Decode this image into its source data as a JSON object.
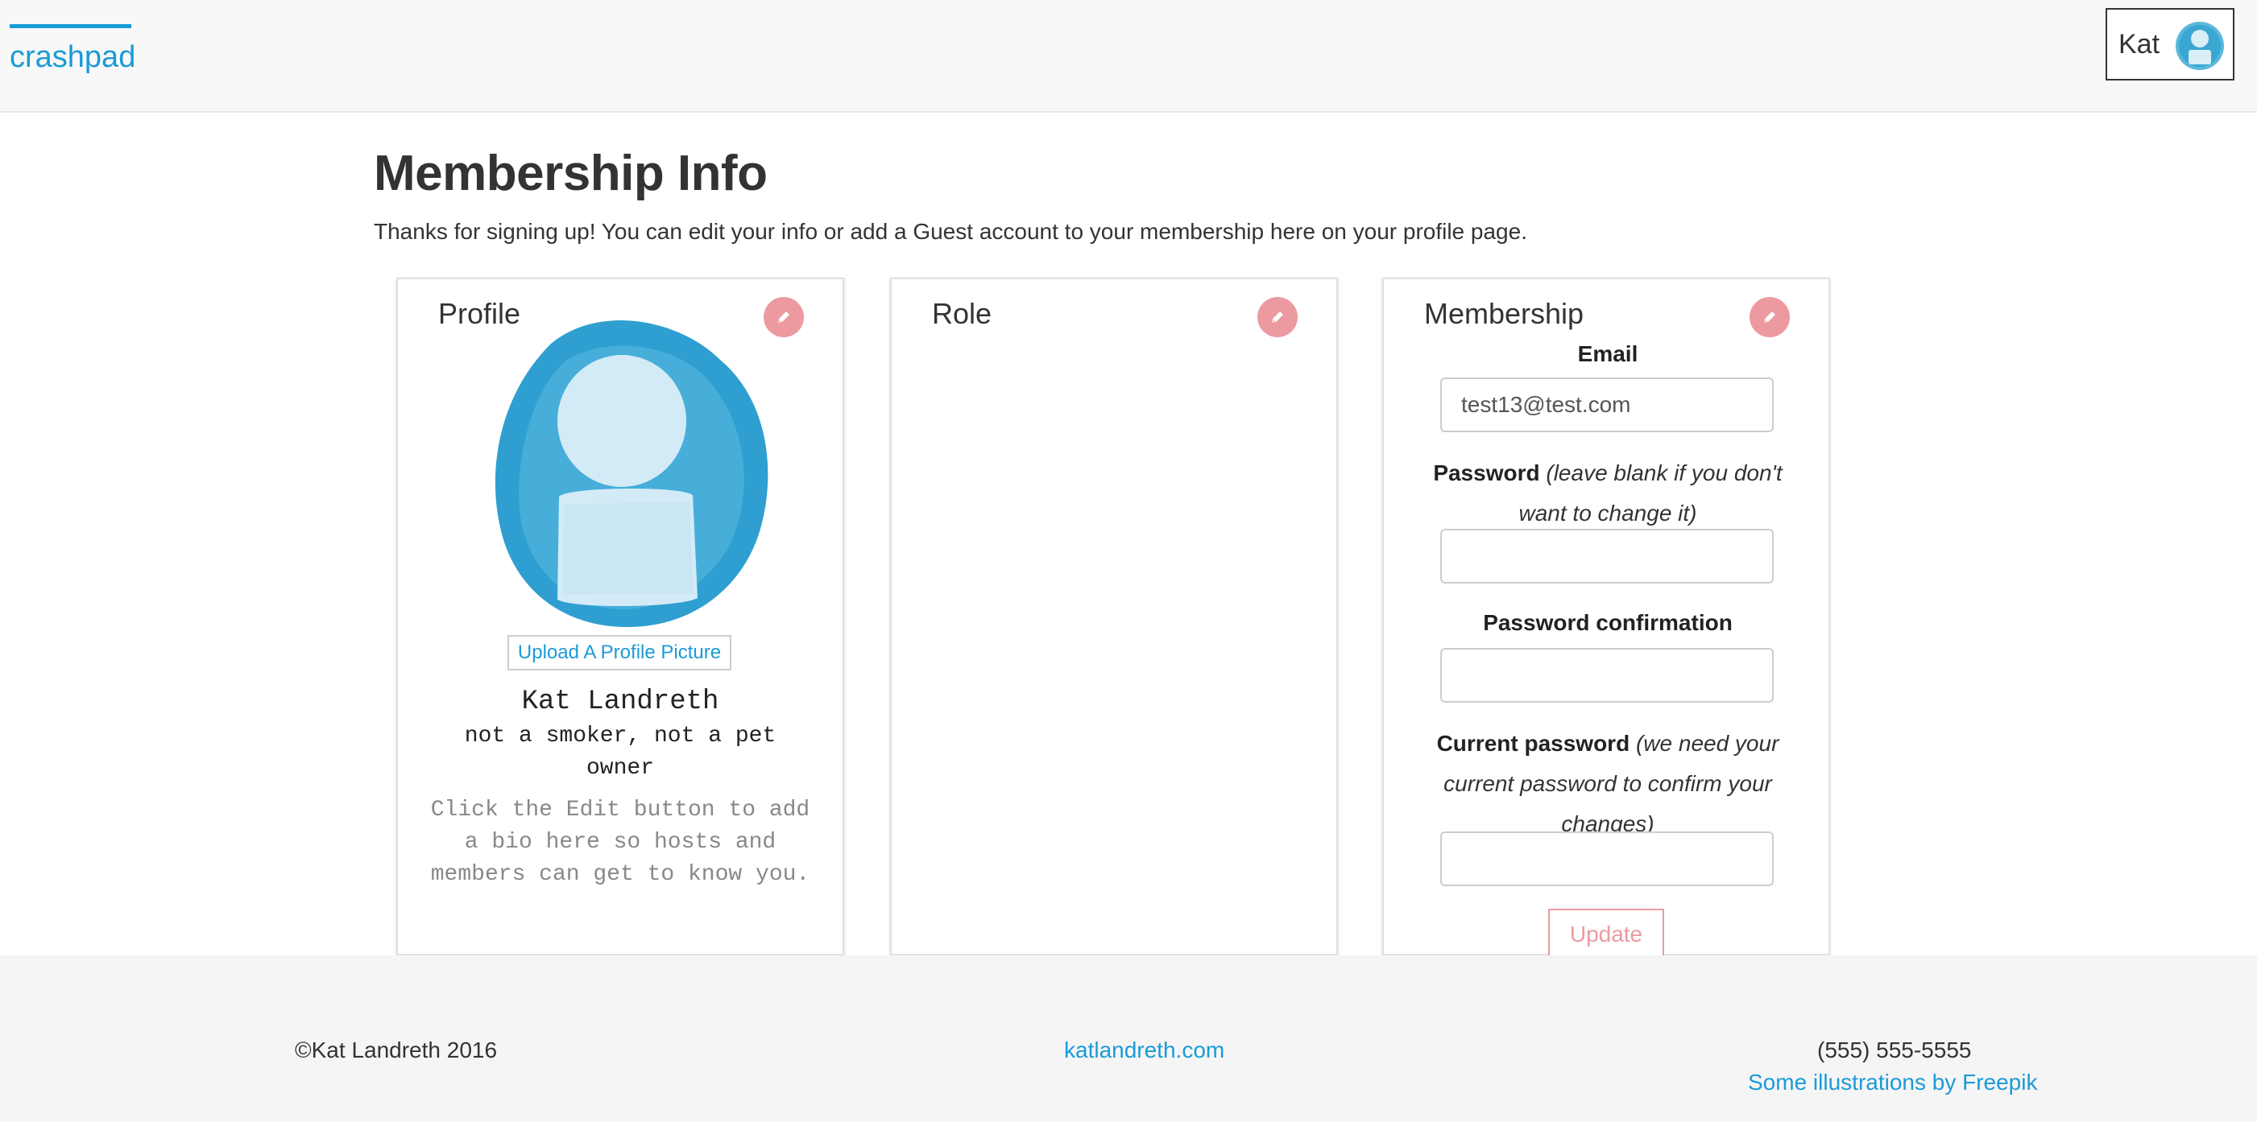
{
  "nav": {
    "brand": "crashpad",
    "user_name": "Kat",
    "avatar_icon": "user-avatar-icon"
  },
  "main": {
    "title": "Membership Info",
    "intro": "Thanks for signing up! You can edit your info or add a Guest account to your membership here on your profile page."
  },
  "profile_card": {
    "title": "Profile",
    "edit_icon": "pencil-icon",
    "upload_label": "Upload A Profile Picture",
    "name": "Kat Landreth",
    "tags": "not a smoker, not a pet owner",
    "bio_hint": "Click the Edit button to add a bio here so hosts and members can get to know you."
  },
  "role_card": {
    "title": "Role",
    "edit_icon": "pencil-icon"
  },
  "membership_card": {
    "title": "Membership",
    "edit_icon": "pencil-icon",
    "email_label": "Email",
    "email_value": "test13@test.com",
    "password_label": "Password",
    "password_hint": "(leave blank if you don't want to change it)",
    "password_value": "",
    "confirm_label": "Password confirmation",
    "confirm_value": "",
    "current_label": "Current password",
    "current_hint": "(we need your current password to confirm your changes)",
    "current_value": "",
    "update_label": "Update"
  },
  "footer": {
    "copyright": "©Kat Landreth 2016",
    "site_link": "katlandreth.com",
    "phone": "(555) 555-5555",
    "credit_link": "Some illustrations by Freepik"
  },
  "colors": {
    "accent": "#1a9bd7",
    "edit_button": "#ec9aa0",
    "navbar_bg": "#f8f8f8",
    "footer_bg": "#f5f5f5"
  }
}
